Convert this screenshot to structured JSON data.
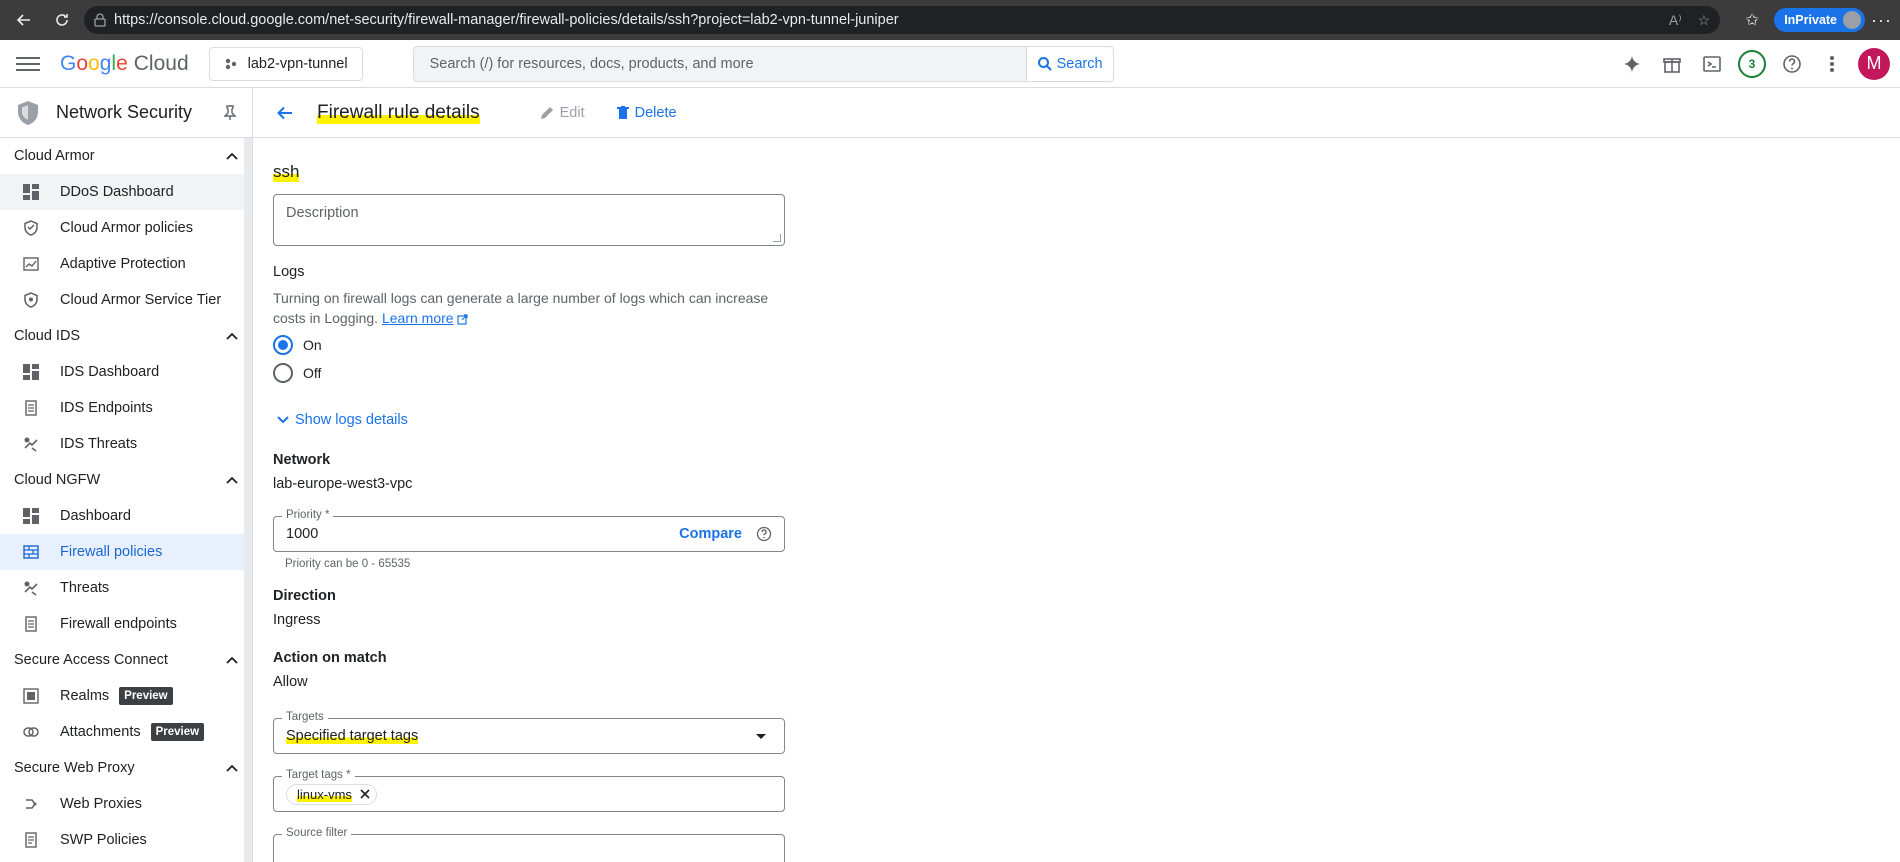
{
  "browser": {
    "url": "https://console.cloud.google.com/net-security/firewall-manager/firewall-policies/details/ssh?project=lab2-vpn-tunnel-juniper",
    "inprivate_label": "InPrivate"
  },
  "header": {
    "logo_google": "Google",
    "logo_cloud": "Cloud",
    "project": "lab2-vpn-tunnel",
    "search_placeholder": "Search (/) for resources, docs, products, and more",
    "search_button": "Search",
    "notification_count": "3",
    "user_initial": "M"
  },
  "sidebar": {
    "title": "Network Security",
    "sections": [
      {
        "label": "Cloud Armor",
        "items": [
          {
            "label": "DDoS Dashboard",
            "icon": "dashboard-icon"
          },
          {
            "label": "Cloud Armor policies",
            "icon": "shield-icon"
          },
          {
            "label": "Adaptive Protection",
            "icon": "chart-icon"
          },
          {
            "label": "Cloud Armor Service Tier",
            "icon": "shield-icon"
          }
        ]
      },
      {
        "label": "Cloud IDS",
        "items": [
          {
            "label": "IDS Dashboard",
            "icon": "dashboard-icon"
          },
          {
            "label": "IDS Endpoints",
            "icon": "endpoint-icon"
          },
          {
            "label": "IDS Threats",
            "icon": "bug-icon"
          }
        ]
      },
      {
        "label": "Cloud NGFW",
        "items": [
          {
            "label": "Dashboard",
            "icon": "dashboard-icon"
          },
          {
            "label": "Firewall policies",
            "icon": "firewall-icon"
          },
          {
            "label": "Threats",
            "icon": "bug-icon"
          },
          {
            "label": "Firewall endpoints",
            "icon": "endpoint-icon"
          }
        ]
      },
      {
        "label": "Secure Access Connect",
        "items": [
          {
            "label": "Realms",
            "icon": "realm-icon",
            "badge": "Preview"
          },
          {
            "label": "Attachments",
            "icon": "link-icon",
            "badge": "Preview"
          }
        ]
      },
      {
        "label": "Secure Web Proxy",
        "items": [
          {
            "label": "Web Proxies",
            "icon": "proxy-icon"
          },
          {
            "label": "SWP Policies",
            "icon": "policy-icon"
          }
        ]
      }
    ]
  },
  "page": {
    "title": "Firewall rule details",
    "edit_label": "Edit",
    "delete_label": "Delete"
  },
  "rule": {
    "name": "ssh",
    "description_placeholder": "Description",
    "logs_label": "Logs",
    "logs_help": "Turning on firewall logs can generate a large number of logs which can increase costs in Logging.",
    "learn_more": "Learn more",
    "log_on": "On",
    "log_off": "Off",
    "show_logs_details": "Show logs details",
    "network_label": "Network",
    "network_value": "lab-europe-west3-vpc",
    "priority_label": "Priority *",
    "priority_value": "1000",
    "compare_label": "Compare",
    "priority_help": "Priority can be 0 - 65535",
    "direction_label": "Direction",
    "direction_value": "Ingress",
    "action_label": "Action on match",
    "action_value": "Allow",
    "targets_label": "Targets",
    "targets_value": "Specified target tags",
    "target_tags_label": "Target tags *",
    "target_tag_chip": "linux-vms",
    "source_filter_label": "Source filter"
  }
}
